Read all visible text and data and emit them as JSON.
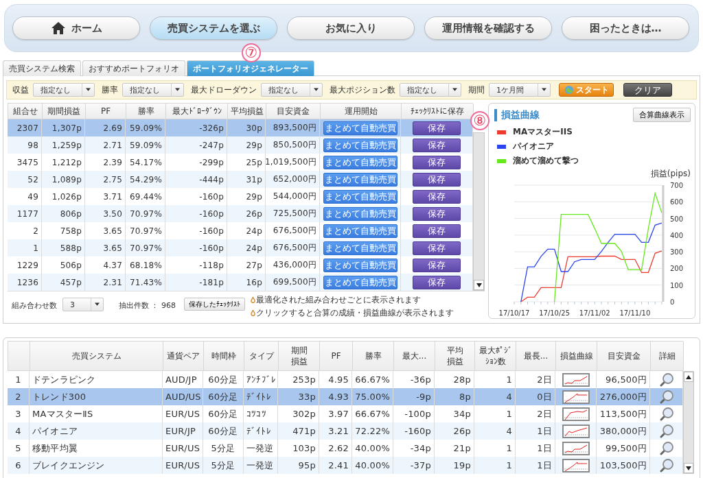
{
  "nav": [
    {
      "label": "ホーム",
      "kind": "home",
      "selected": false
    },
    {
      "label": "売買システムを選ぶ",
      "kind": "plain",
      "selected": true
    },
    {
      "label": "お気に入り",
      "kind": "plain",
      "selected": false
    },
    {
      "label": "運用情報を確認する",
      "kind": "plain",
      "selected": false
    },
    {
      "label": "困ったときは…",
      "kind": "plain",
      "selected": false
    }
  ],
  "callouts": [
    "⑦",
    "⑧"
  ],
  "tabs": [
    {
      "label": "売買システム検索",
      "selected": false
    },
    {
      "label": "おすすめポートフォリオ",
      "selected": false
    },
    {
      "label": "ポートフォリオジェネレーター",
      "selected": true
    }
  ],
  "filters": [
    {
      "label": "収益",
      "value": "指定なし"
    },
    {
      "label": "勝率",
      "value": "指定なし"
    },
    {
      "label": "最大ドローダウン",
      "value": "指定なし"
    },
    {
      "label": "最大ポジション数",
      "value": "指定なし"
    },
    {
      "label": "期間",
      "value": "1ケ月間"
    }
  ],
  "filter_buttons": [
    {
      "label": "スタート",
      "kind": "start"
    },
    {
      "label": "クリア",
      "kind": "clear"
    }
  ],
  "combo_table": {
    "columns": [
      "組合せ",
      "期間損益",
      "PF",
      "勝率",
      "最大ﾄﾞﾛｰﾀﾞｳﾝ",
      "平均損益",
      "目安資金",
      "運用開始",
      "ﾁｪｯｸﾘｽﾄに保存"
    ],
    "rows": [
      {
        "selected": true,
        "cells": [
          "2307",
          "1,307p",
          "2.69",
          "59.09%",
          "-326p",
          "30p",
          "893,500円"
        ],
        "start": "まとめて自動売買",
        "save": "保存"
      },
      {
        "selected": false,
        "cells": [
          "98",
          "1,259p",
          "2.71",
          "59.09%",
          "-247p",
          "29p",
          "850,500円"
        ],
        "start": "まとめて自動売買",
        "save": "保存"
      },
      {
        "selected": false,
        "cells": [
          "3475",
          "1,212p",
          "2.39",
          "54.17%",
          "-299p",
          "25p",
          "1,019,500円"
        ],
        "start": "まとめて自動売買",
        "save": "保存"
      },
      {
        "selected": false,
        "cells": [
          "52",
          "1,089p",
          "2.75",
          "54.29%",
          "-444p",
          "31p",
          "652,000円"
        ],
        "start": "まとめて自動売買",
        "save": "保存"
      },
      {
        "selected": false,
        "cells": [
          "49",
          "1,026p",
          "3.71",
          "69.44%",
          "-160p",
          "29p",
          "544,000円"
        ],
        "start": "まとめて自動売買",
        "save": "保存"
      },
      {
        "selected": false,
        "cells": [
          "1177",
          "806p",
          "3.50",
          "70.97%",
          "-160p",
          "26p",
          "725,500円"
        ],
        "start": "まとめて自動売買",
        "save": "保存"
      },
      {
        "selected": false,
        "cells": [
          "2",
          "758p",
          "3.65",
          "70.97%",
          "-160p",
          "24p",
          "676,500円"
        ],
        "start": "まとめて自動売買",
        "save": "保存"
      },
      {
        "selected": false,
        "cells": [
          "1",
          "588p",
          "3.65",
          "70.97%",
          "-160p",
          "24p",
          "676,500円"
        ],
        "start": "まとめて自動売買",
        "save": "保存"
      },
      {
        "selected": false,
        "cells": [
          "1229",
          "506p",
          "4.37",
          "68.18%",
          "-118p",
          "27p",
          "436,000円"
        ],
        "start": "まとめて自動売買",
        "save": "保存"
      },
      {
        "selected": false,
        "cells": [
          "1236",
          "457p",
          "2.31",
          "71.43%",
          "-181p",
          "16p",
          "699,500円"
        ],
        "start": "まとめて自動売買",
        "save": "保存"
      }
    ]
  },
  "combo_footer": {
    "count_label": "組み合わせ数",
    "count_value": "3",
    "extracted": "抽出件数 ： 968",
    "checklist_button": "保存したﾁｪｯｸﾘｽﾄ",
    "notes": [
      "最適化された組み合わせごとに表示されます",
      "クリックすると合算の成績・損益曲線が表示されます"
    ]
  },
  "chart_panel": {
    "title": "損益曲線",
    "button": "合算曲線表示",
    "chart_data": {
      "type": "line",
      "ylabel": "損益(pips)",
      "categories": [
        "17/10/17",
        null,
        null,
        null,
        null,
        null,
        "17/10/25",
        null,
        null,
        null,
        null,
        null,
        "17/11/02",
        null,
        null,
        null,
        null,
        null,
        "17/11/10",
        null,
        null,
        null,
        null
      ],
      "ylim": [
        0,
        700
      ],
      "grid": true,
      "yticks": [
        0,
        100,
        200,
        300,
        400,
        500,
        600,
        700
      ],
      "series": [
        {
          "name": "MAマスターIIS",
          "color": "#ee3b2f",
          "values": [
            null,
            0,
            27,
            27,
            85,
            85,
            85,
            85,
            270,
            270,
            270,
            270,
            270,
            274,
            274,
            274,
            254,
            254,
            254,
            176,
            176,
            291,
            305
          ]
        },
        {
          "name": "パイオニア",
          "color": "#2a44f0",
          "values": [
            null,
            0,
            209,
            209,
            272,
            316,
            316,
            181,
            181,
            240,
            254,
            254,
            254,
            302,
            357,
            405,
            405,
            405,
            405,
            357,
            357,
            460,
            473
          ]
        },
        {
          "name": "溜めて溜めて撃つ",
          "color": "#66e81c",
          "values": [
            null,
            null,
            null,
            null,
            null,
            null,
            0,
            524,
            524,
            524,
            524,
            524,
            440,
            350,
            350,
            350,
            302,
            192,
            192,
            192,
            440,
            652,
            535
          ]
        }
      ]
    }
  },
  "system_table": {
    "columns": [
      "",
      "売買システム",
      "通貨ペア",
      "時間枠",
      "タイプ",
      "期間損益",
      "PF",
      "勝率",
      "最大...",
      "平均損益",
      "最大ﾎﾟｼﾞｼｮﾝ数",
      "最長...",
      "損益曲線",
      "目安資金",
      "詳細"
    ],
    "rows": [
      {
        "selected": false,
        "cells": [
          "1",
          "ドテンラピンク",
          "AUD/JP",
          "60分足",
          "ｱﾝﾁﾌﾞﾚ",
          "253p",
          "4.95",
          "66.67%",
          "-36p",
          "28p",
          "1",
          "2日",
          "96,500円"
        ]
      },
      {
        "selected": true,
        "cells": [
          "2",
          "トレンド300",
          "AUD/US",
          "60分足",
          "ﾃﾞｲﾄﾚ",
          "33p",
          "4.93",
          "75.00%",
          "-9p",
          "8p",
          "4",
          "0日",
          "276,000円"
        ]
      },
      {
        "selected": false,
        "cells": [
          "3",
          "MAマスターⅡS",
          "EUR/US",
          "60分足",
          "ｺﾂｺﾂ",
          "302p",
          "3.97",
          "66.67%",
          "-100p",
          "34p",
          "1",
          "2日",
          "113,500円"
        ]
      },
      {
        "selected": false,
        "cells": [
          "4",
          "パイオニア",
          "EUR/JP",
          "60分足",
          "ﾃﾞｲﾄﾚ",
          "471p",
          "3.21",
          "72.22%",
          "-160p",
          "26p",
          "4",
          "1日",
          "380,000円"
        ]
      },
      {
        "selected": false,
        "cells": [
          "5",
          "移動平均翼",
          "EUR/US",
          "5分足",
          "一発逆",
          "103p",
          "2.62",
          "40.00%",
          "-34p",
          "21p",
          "1",
          "1日",
          "99,500円"
        ]
      },
      {
        "selected": false,
        "cells": [
          "6",
          "ブレイクエンジン",
          "EUR/US",
          "5分足",
          "一発逆",
          "95p",
          "2.41",
          "40.00%",
          "-37p",
          "19p",
          "1",
          "1日",
          "103,500円"
        ]
      }
    ]
  }
}
